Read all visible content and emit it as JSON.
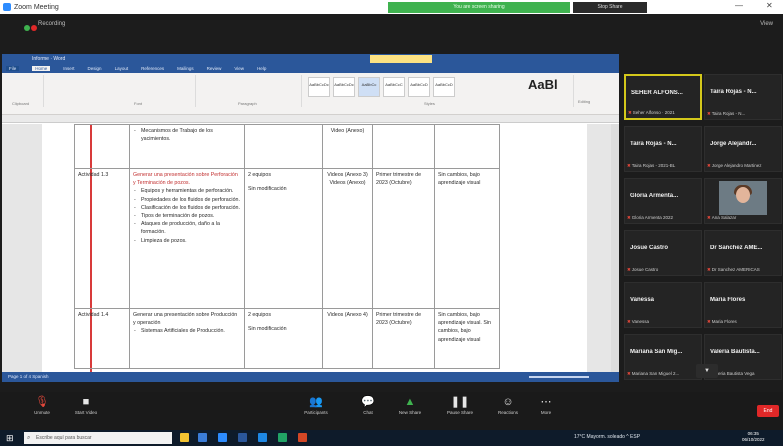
{
  "window": {
    "title": "Zoom Meeting",
    "share_banner": "You are screen sharing",
    "stop_share_label": "Stop Share",
    "minimize": "—",
    "close": "✕"
  },
  "top": {
    "meeting_label": "Recording",
    "view_label": "View"
  },
  "word": {
    "title": "Informe · Word",
    "tabs": [
      "File",
      "Home",
      "Insert",
      "Design",
      "Layout",
      "References",
      "Mailings",
      "Review",
      "View",
      "Help"
    ],
    "active_tab": "Home",
    "style_boxes": [
      "AaBbCcDc",
      "AaBbCcDc",
      "AaBbCc",
      "AaBbCcC",
      "AaBbCcD",
      "AaBbCcD"
    ],
    "style_big": "AaBl",
    "ribbon_groups": [
      "Clipboard",
      "Font",
      "Paragraph",
      "Styles",
      "Editing"
    ],
    "status": "Page 1 of 4   Spanish",
    "table": {
      "row0": {
        "bullets": [
          "Mecanismos de Trabajo de los yacimientos."
        ],
        "col3": "Video (Anexo)"
      },
      "row1": {
        "id": "Actividad 1.3",
        "heading": "Generar una presentación sobre Perforación y Terminación de pozos.",
        "bullets": [
          "Equipos y herramientas de perforación.",
          "Propiedades de los fluidos de perforación.",
          "Clasificación de los fluidos de perforación.",
          "Tipos de terminación de pozos.",
          "Ataques de producción, daño a la formación.",
          "Limpieza de pozos."
        ],
        "resource_a": "2 equipos",
        "resource_b": "Sin modificación",
        "media": "Videos (Anexo 3) Videos (Anexo)",
        "date": "Primer trimestre de 2023 (Octubre)",
        "result": "Sin cambios, bajo aprendizaje visual"
      },
      "row2": {
        "id": "Actividad 1.4",
        "heading": "Generar una presentación sobre Producción y operación",
        "bullets": [
          "Sistemas Artificiales de Producción."
        ],
        "resource_a": "2 equipos",
        "resource_b": "Sin modificación",
        "media": "Videos (Anexo 4)",
        "date": "Primer trimestre de 2023 (Octubre)",
        "result": "Sin cambios, bajo aprendizaje visual. Sin cambios, bajo aprendizaje visual"
      }
    }
  },
  "participants": [
    {
      "name": "SEHER ALFONS...",
      "caption": "Seher Alfonso · 2021",
      "active": true,
      "video": false
    },
    {
      "name": "Taira Rojas - N...",
      "caption": "Taira Rojas - N...",
      "active": false,
      "video": false
    },
    {
      "name": "Taira Rojas - N...",
      "caption": "Taira Rojas - 2021-BL",
      "active": false,
      "video": false
    },
    {
      "name": "Jorge Alejandr...",
      "caption": "Jorge Alejandro Martinez",
      "active": false,
      "video": false
    },
    {
      "name": "Gloria Armenta...",
      "caption": "Gloria Armenta 2022",
      "active": false,
      "video": false
    },
    {
      "name": "",
      "caption": "Ana Salazar",
      "active": false,
      "video": true
    },
    {
      "name": "Josue Castro",
      "caption": "Josue Castro",
      "active": false,
      "video": false
    },
    {
      "name": "Dr Sanchez AME...",
      "caption": "Dr Sanchez AMERICAS",
      "active": false,
      "video": false
    },
    {
      "name": "Vanessa",
      "caption": "Vanessa",
      "active": false,
      "video": false
    },
    {
      "name": "Maria Flores",
      "caption": "Maria Flores",
      "active": false,
      "video": false
    },
    {
      "name": "Mariana San Mig...",
      "caption": "Mariana San Miguel 2...",
      "active": false,
      "video": false
    },
    {
      "name": "Valeria Bautista...",
      "caption": "Valeria Bautista Vega",
      "active": false,
      "video": false
    }
  ],
  "controls": [
    {
      "icon": "🎙",
      "label": "Unmute"
    },
    {
      "icon": "■",
      "label": "Start Video"
    },
    {
      "icon": "👥",
      "label": "Participants"
    },
    {
      "icon": "💬",
      "label": "Chat"
    },
    {
      "icon": "▲",
      "label": "New Share"
    },
    {
      "icon": "❚❚",
      "label": "Pause Share"
    },
    {
      "icon": "☺",
      "label": "Reactions"
    },
    {
      "icon": "⋯",
      "label": "More"
    }
  ],
  "end_label": "End",
  "taskbar": {
    "search_placeholder": "Escribe aquí para buscar",
    "tray_text": "17°C  Mayorm. soleado  ^  ESP",
    "time": "06:35",
    "date": "06/10/2022"
  },
  "colors": {
    "word_blue": "#2b579a",
    "share_green": "#3fb24f",
    "active_tile": "#d4c81b",
    "end_red": "#e02828"
  }
}
